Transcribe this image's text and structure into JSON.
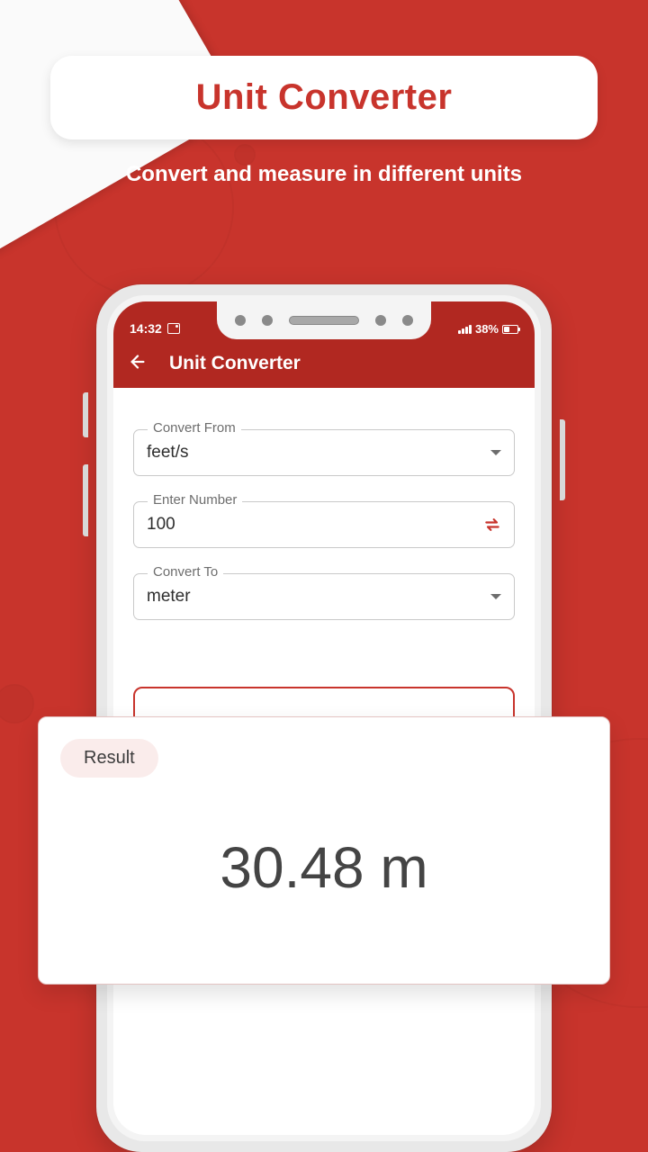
{
  "promo": {
    "title": "Unit Converter",
    "subtitle": "Convert and measure in different units"
  },
  "status": {
    "time": "14:32",
    "battery_pct": "38%"
  },
  "header": {
    "title": "Unit Converter"
  },
  "form": {
    "from_label": "Convert From",
    "from_value": "feet/s",
    "number_label": "Enter Number",
    "number_value": "100",
    "to_label": "Convert To",
    "to_value": "meter",
    "hidden_preview": "30.48"
  },
  "result": {
    "label": "Result",
    "value": "30.48 m"
  },
  "colors": {
    "accent": "#c8342c",
    "header": "#b12821"
  }
}
